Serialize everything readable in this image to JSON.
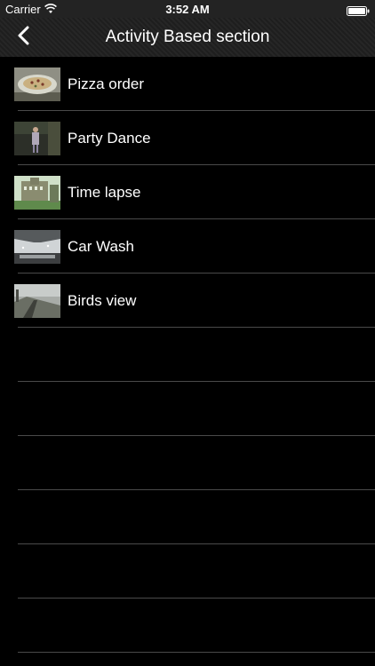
{
  "status_bar": {
    "carrier": "Carrier",
    "time": "3:52 AM"
  },
  "nav": {
    "title": "Activity Based section",
    "back_icon": "chevron-left-icon"
  },
  "rows": [
    {
      "label": "Pizza order"
    },
    {
      "label": "Party Dance"
    },
    {
      "label": "Time lapse"
    },
    {
      "label": "Car Wash"
    },
    {
      "label": "Birds view"
    }
  ],
  "colors": {
    "background": "#000000",
    "separator": "#4a4a4a",
    "text": "#ffffff"
  }
}
